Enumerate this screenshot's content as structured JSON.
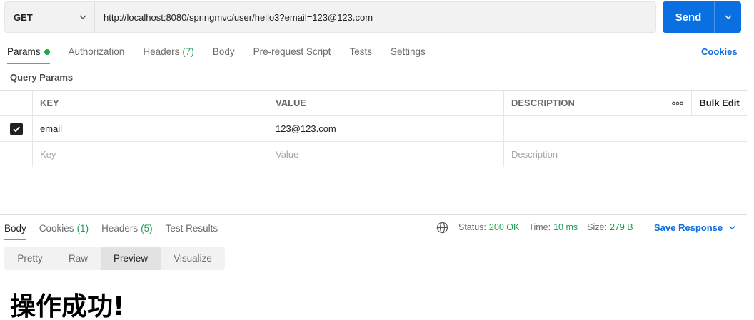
{
  "request": {
    "method": "GET",
    "url": "http://localhost:8080/springmvc/user/hello3?email=123@123.com",
    "send_label": "Send"
  },
  "request_tabs": [
    {
      "label": "Params",
      "active": true,
      "dot": true
    },
    {
      "label": "Authorization"
    },
    {
      "label": "Headers",
      "count": "(7)"
    },
    {
      "label": "Body"
    },
    {
      "label": "Pre-request Script"
    },
    {
      "label": "Tests"
    },
    {
      "label": "Settings"
    }
  ],
  "cookies_label": "Cookies",
  "query_params": {
    "title": "Query Params",
    "headers": {
      "key": "KEY",
      "value": "VALUE",
      "description": "DESCRIPTION",
      "more": "ooo",
      "bulk_edit": "Bulk Edit"
    },
    "rows": [
      {
        "checked": true,
        "key": "email",
        "value": "123@123.com",
        "description": ""
      }
    ],
    "placeholders": {
      "key": "Key",
      "value": "Value",
      "description": "Description"
    }
  },
  "response_tabs": [
    {
      "label": "Body",
      "active": true
    },
    {
      "label": "Cookies",
      "count": "(1)"
    },
    {
      "label": "Headers",
      "count": "(5)"
    },
    {
      "label": "Test Results"
    }
  ],
  "status": {
    "status_label": "Status:",
    "status_value": "200 OK",
    "time_label": "Time:",
    "time_value": "10 ms",
    "size_label": "Size:",
    "size_value": "279 B"
  },
  "save_response_label": "Save Response",
  "view_modes": [
    {
      "label": "Pretty"
    },
    {
      "label": "Raw"
    },
    {
      "label": "Preview",
      "active": true
    },
    {
      "label": "Visualize"
    }
  ],
  "response_body": "操作成功!",
  "colors": {
    "accent": "#0a6fe0",
    "tab_underline": "#f26b3a",
    "success": "#1f9d55"
  }
}
